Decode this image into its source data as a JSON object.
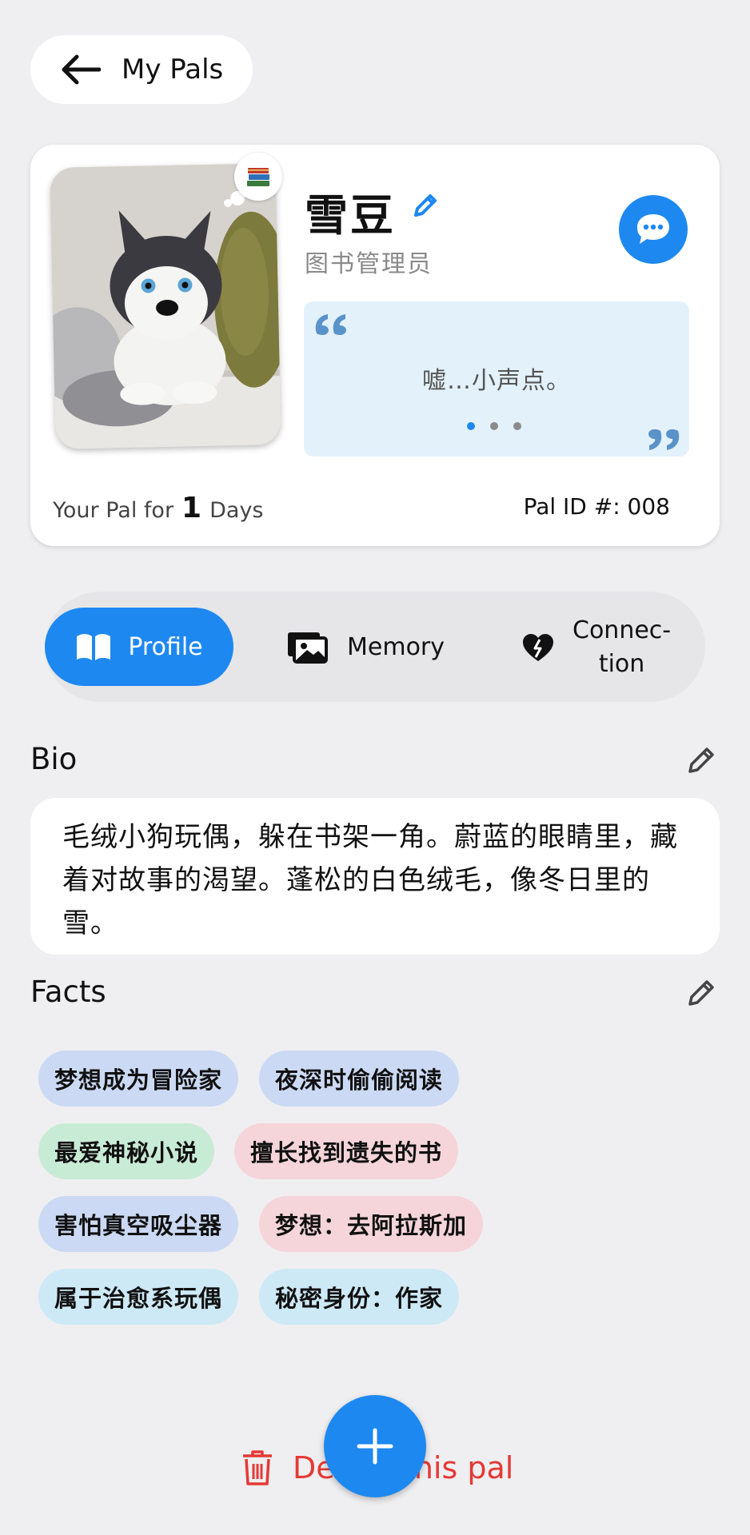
{
  "header": {
    "back_label": "My Pals"
  },
  "pal": {
    "name": "雪豆",
    "role": "图书管理员",
    "quote": "嘘…小声点。",
    "days_prefix": "Your Pal for",
    "days_count": "1",
    "days_suffix": "Days",
    "pal_id": "Pal ID #: 008"
  },
  "tabs": [
    {
      "label": "Profile",
      "icon": "book-icon",
      "active": true
    },
    {
      "label": "Memory",
      "icon": "photos-icon",
      "active": false
    },
    {
      "label_line1": "Connec-",
      "label_line2": "tion",
      "icon": "broken-heart-icon",
      "active": false
    }
  ],
  "bio": {
    "title": "Bio",
    "text": "毛绒小狗玩偶，躲在书架一角。蔚蓝的眼睛里，藏着对故事的渴望。蓬松的白色绒毛，像冬日里的雪。"
  },
  "facts": {
    "title": "Facts",
    "items": [
      "梦想成为冒险家",
      "夜深时偷偷阅读",
      "最爱神秘小说",
      "擅长找到遗失的书",
      "害怕真空吸尘器",
      "梦想：去阿拉斯加",
      "属于治愈系玩偶",
      "秘密身份：作家"
    ]
  },
  "footer": {
    "delete_label": "Delete this pal"
  },
  "colors": {
    "accent": "#1e88f1",
    "chip_blue": "#cbd9f4",
    "chip_green": "#c8ebd6",
    "chip_pink": "#f5d5da",
    "chip_cyan": "#cde9f6",
    "danger": "#e53935"
  }
}
